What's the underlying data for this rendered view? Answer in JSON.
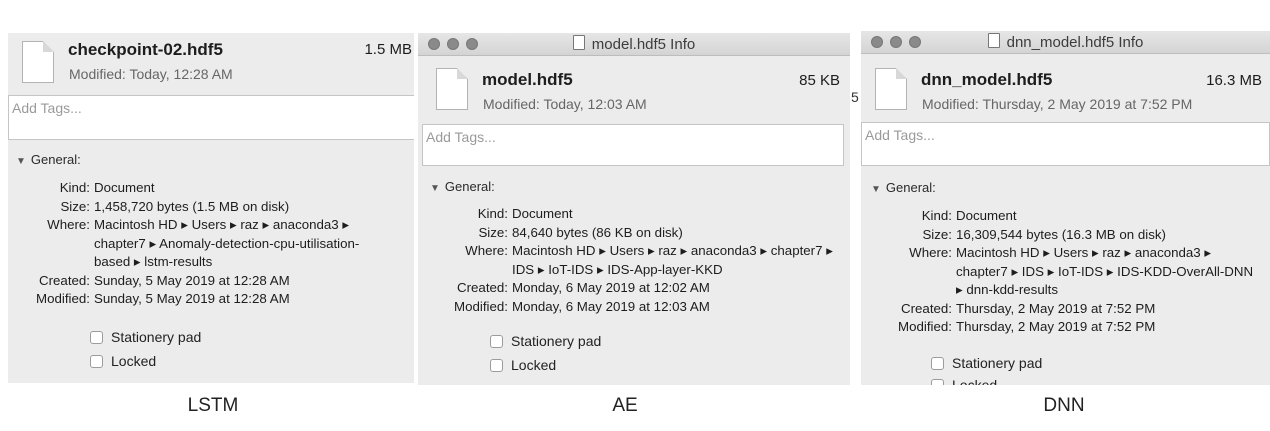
{
  "panels": [
    {
      "window_title": "",
      "file_name": "checkpoint-02.hdf5",
      "file_size": "1.5 MB",
      "modified_line": "Modified: Today, 12:28 AM",
      "tags_placeholder": "Add Tags...",
      "section_label": "General:",
      "info": {
        "kind_label": "Kind:",
        "kind": "Document",
        "size_label": "Size:",
        "size": "1,458,720 bytes (1.5 MB on disk)",
        "where_label": "Where:",
        "where": "Macintosh HD ▸ Users ▸ raz ▸ anaconda3 ▸ chapter7 ▸ Anomaly-detection-cpu-utilisation-based ▸ lstm-results",
        "created_label": "Created:",
        "created": "Sunday, 5 May 2019 at 12:28 AM",
        "modified_label": "Modified:",
        "modified": "Sunday, 5 May 2019 at 12:28 AM"
      },
      "stationery_label": "Stationery pad",
      "locked_label": "Locked",
      "caption": "LSTM"
    },
    {
      "window_title": "model.hdf5 Info",
      "file_name": "model.hdf5",
      "file_size": "85 KB",
      "modified_line": "Modified: Today, 12:03 AM",
      "tags_placeholder": "Add Tags...",
      "section_label": "General:",
      "info": {
        "kind_label": "Kind:",
        "kind": "Document",
        "size_label": "Size:",
        "size": "84,640 bytes (86 KB on disk)",
        "where_label": "Where:",
        "where": "Macintosh HD ▸ Users ▸ raz ▸ anaconda3 ▸ chapter7 ▸ IDS ▸ IoT-IDS ▸ IDS-App-layer-KKD",
        "created_label": "Created:",
        "created": "Monday, 6 May 2019 at 12:02 AM",
        "modified_label": "Modified:",
        "modified": "Monday, 6 May 2019 at 12:03 AM"
      },
      "stationery_label": "Stationery pad",
      "locked_label": "Locked",
      "caption": "AE"
    },
    {
      "window_title": "dnn_model.hdf5 Info",
      "file_name": "dnn_model.hdf5",
      "file_size": "16.3 MB",
      "modified_line": "Modified: Thursday, 2 May 2019 at 7:52 PM",
      "tags_placeholder": "Add Tags...",
      "section_label": "General:",
      "info": {
        "kind_label": "Kind:",
        "kind": "Document",
        "size_label": "Size:",
        "size": "16,309,544 bytes (16.3 MB on disk)",
        "where_label": "Where:",
        "where": "Macintosh HD ▸ Users ▸ raz ▸ anaconda3 ▸ chapter7 ▸ IDS ▸ IoT-IDS ▸ IDS-KDD-OverAll-DNN ▸ dnn-kdd-results",
        "created_label": "Created:",
        "created": "Thursday, 2 May 2019 at 7:52 PM",
        "modified_label": "Modified:",
        "modified": "Thursday, 2 May 2019 at 7:52 PM"
      },
      "stationery_label": "Stationery pad",
      "locked_label": "Locked",
      "caption": "DNN"
    }
  ],
  "fragments": {
    "behind_window": "5"
  }
}
